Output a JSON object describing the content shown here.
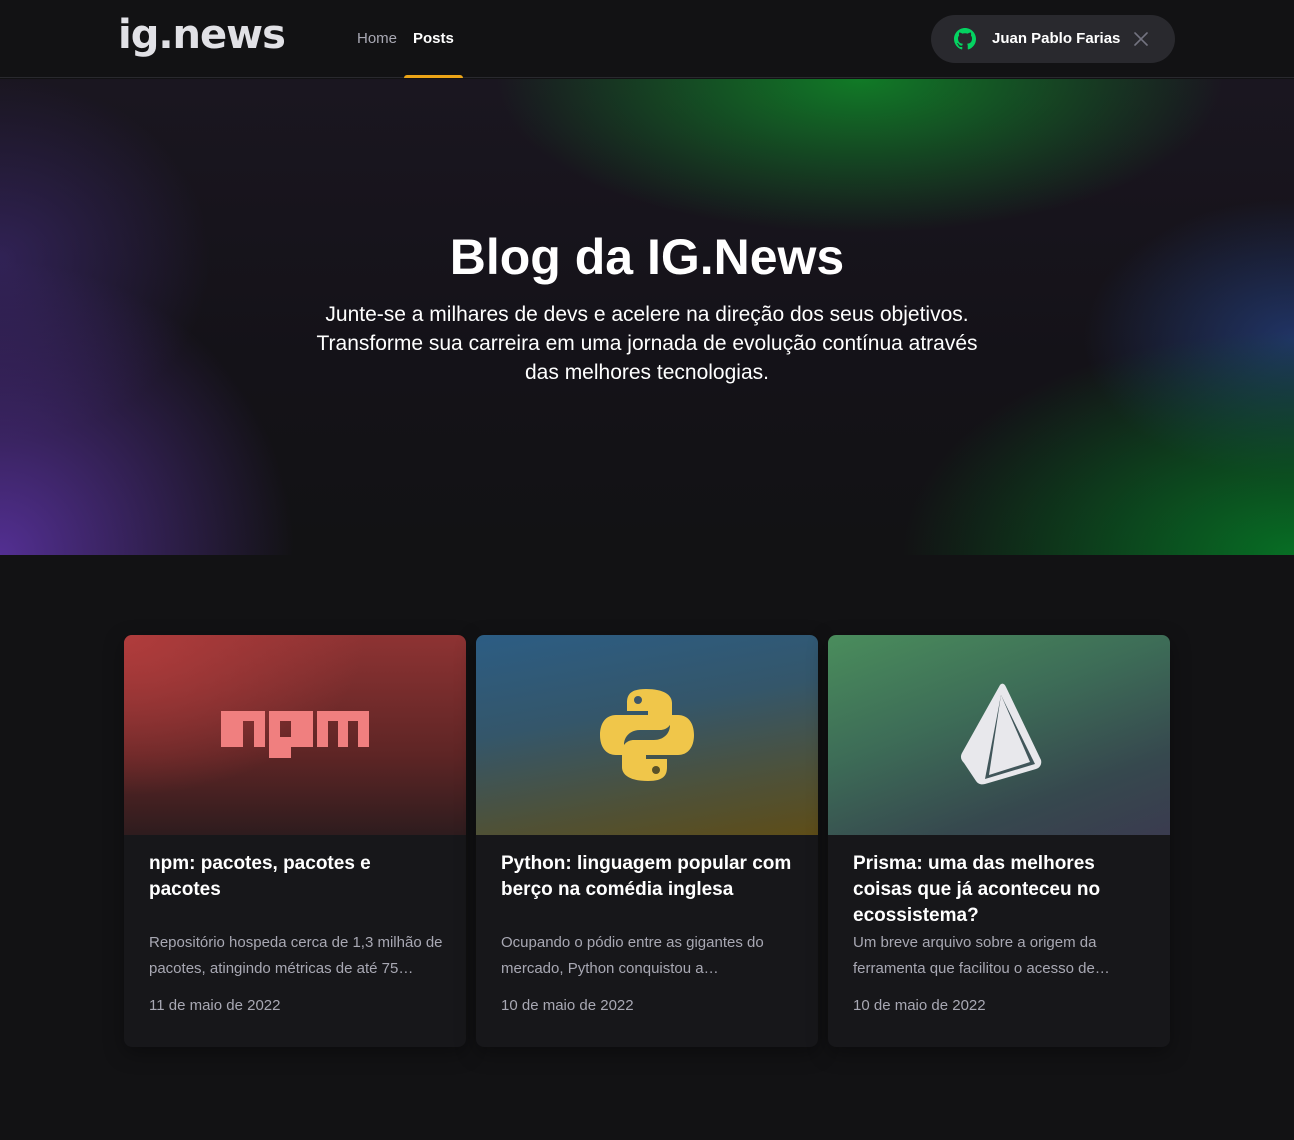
{
  "header": {
    "logo": "ig.news",
    "nav": [
      {
        "label": "Home",
        "active": false
      },
      {
        "label": "Posts",
        "active": true
      }
    ],
    "user": {
      "name": "Juan Pablo Farias",
      "icon": "github-icon",
      "close_icon": "close-icon"
    }
  },
  "hero": {
    "title": "Blog da IG.News",
    "subtitle": "Junte-se a milhares de devs e acelere na direção dos seus objetivos. Transforme sua carreira em uma jornada de evolução contínua através das melhores tecnologias."
  },
  "posts": [
    {
      "image": "npm-logo",
      "title": "npm: pacotes, pacotes e pacotes",
      "excerpt": "Repositório hospeda cerca de 1,3 milhão de pacotes, atingindo métricas de até 75…",
      "date": "11 de maio de 2022"
    },
    {
      "image": "python-logo",
      "title": "Python: linguagem popular com berço na comédia inglesa",
      "excerpt": "Ocupando o pódio entre as gigantes do mercado, Python conquistou a…",
      "date": "10 de maio de 2022"
    },
    {
      "image": "prisma-logo",
      "title": "Prisma: uma das melhores coisas que já aconteceu no ecossistema?",
      "excerpt": "Um breve arquivo sobre a origem da ferramenta que facilitou o acesso de…",
      "date": "10 de maio de 2022"
    }
  ],
  "colors": {
    "background": "#121214",
    "accent": "#eba417",
    "github_green": "#04d361",
    "muted_text": "#a8a8b3"
  }
}
